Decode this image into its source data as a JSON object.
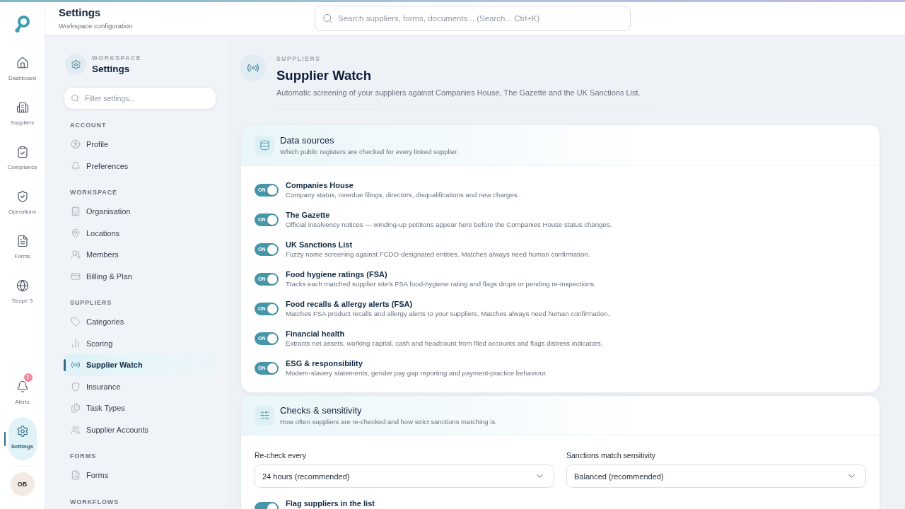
{
  "rail": {
    "main_items": [
      {
        "label": "Dashboard",
        "selected": false
      },
      {
        "label": "Suppliers",
        "selected": false
      },
      {
        "label": "Compliance",
        "selected": false
      },
      {
        "label": "Operations",
        "selected": false
      },
      {
        "label": "Forms",
        "selected": false
      },
      {
        "label": "Scope 3",
        "selected": false
      }
    ],
    "bottom_items": [
      {
        "label": "Alerts",
        "selected": false,
        "badge": "7"
      },
      {
        "label": "Settings",
        "selected": true
      }
    ],
    "avatar": "OB"
  },
  "header": {
    "title": "Settings",
    "subtitle": "Workspace configuration",
    "search": {
      "placeholder": "Search suppliers, forms, documents... (Search... Ctrl+K)"
    }
  },
  "settings_nav": {
    "eyebrow": "WORKSPACE",
    "title": "Settings",
    "filter": {
      "placeholder": "Filter settings..."
    },
    "sections": [
      {
        "heading": "ACCOUNT",
        "items": [
          {
            "label": "Profile",
            "selected": false
          },
          {
            "label": "Preferences",
            "selected": false
          }
        ]
      },
      {
        "heading": "WORKSPACE",
        "items": [
          {
            "label": "Organisation",
            "selected": false
          },
          {
            "label": "Locations",
            "selected": false
          },
          {
            "label": "Members",
            "selected": false
          },
          {
            "label": "Billing & Plan",
            "selected": false
          }
        ]
      },
      {
        "heading": "SUPPLIERS",
        "items": [
          {
            "label": "Categories",
            "selected": false
          },
          {
            "label": "Scoring",
            "selected": false
          },
          {
            "label": "Supplier Watch",
            "selected": true
          },
          {
            "label": "Insurance",
            "selected": false
          },
          {
            "label": "Task Types",
            "selected": false
          },
          {
            "label": "Supplier Accounts",
            "selected": false
          }
        ]
      },
      {
        "heading": "FORMS",
        "items": [
          {
            "label": "Forms",
            "selected": false
          }
        ]
      },
      {
        "heading": "WORKFLOWS"
      }
    ]
  },
  "page": {
    "eyebrow": "SUPPLIERS",
    "title": "Supplier Watch",
    "description": "Automatic screening of your suppliers against Companies House, The Gazette and the UK Sanctions List."
  },
  "data_sources": {
    "title": "Data sources",
    "subtitle": "Which public registers are checked for every linked supplier.",
    "sources": [
      {
        "name": "Companies House",
        "description": "Company status, overdue filings, directors, disqualifications and new charges.",
        "on": true,
        "toggle_text": "ON"
      },
      {
        "name": "The Gazette",
        "description": "Official insolvency notices — winding-up petitions appear here before the Companies House status changes.",
        "on": true,
        "toggle_text": "ON"
      },
      {
        "name": "UK Sanctions List",
        "description": "Fuzzy name screening against FCDO-designated entities. Matches always need human confirmation.",
        "on": true,
        "toggle_text": "ON"
      },
      {
        "name": "Food hygiene ratings (FSA)",
        "description": "Tracks each matched supplier site's FSA food-hygiene rating and flags drops or pending re-inspections.",
        "on": true,
        "toggle_text": "ON"
      },
      {
        "name": "Food recalls & allergy alerts (FSA)",
        "description": "Matches FSA product recalls and allergy alerts to your suppliers. Matches always need human confirmation.",
        "on": true,
        "toggle_text": "ON"
      },
      {
        "name": "Financial health",
        "description": "Extracts net assets, working capital, cash and headcount from filed accounts and flags distress indicators.",
        "on": true,
        "toggle_text": "ON"
      },
      {
        "name": "ESG & responsibility",
        "description": "Modern-slavery statements, gender pay gap reporting and payment-practice behaviour.",
        "on": true,
        "toggle_text": "ON"
      }
    ]
  },
  "checks": {
    "title": "Checks & sensitivity",
    "subtitle": "How often suppliers are re-checked and how strict sanctions matching is.",
    "fields": [
      {
        "label": "Re-check every",
        "value": "24 hours (recommended)"
      },
      {
        "label": "Sanctions match sensitivity",
        "value": "Balanced (recommended)"
      }
    ],
    "options": [
      {
        "name": "Flag suppliers in the list",
        "on": true
      }
    ]
  }
}
